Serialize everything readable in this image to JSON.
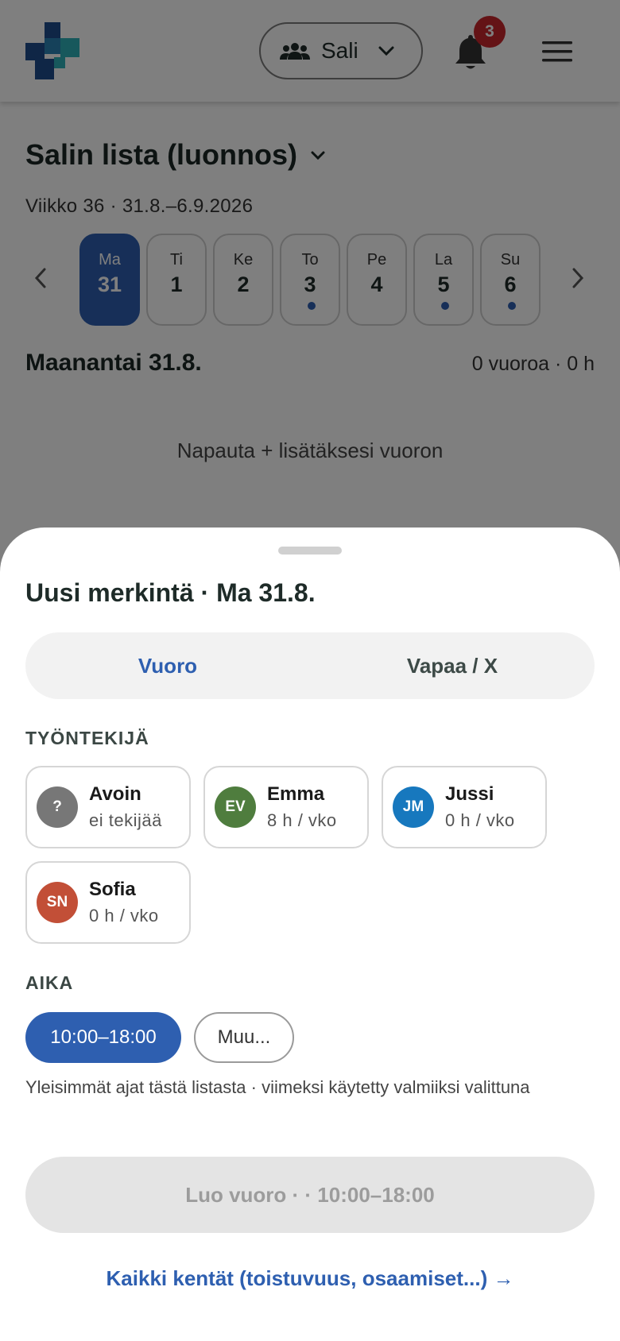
{
  "colors": {
    "accent": "#2e5fb0",
    "badge": "#c8272c",
    "open_avatar": "#777777",
    "emma_avatar": "#4f7d3e",
    "jussi_avatar": "#1778be",
    "sofia_avatar": "#c24f37",
    "logo_dark": "#1f4d8c",
    "logo_light": "#2eb0b8"
  },
  "header": {
    "logo_icon": "app-logo",
    "team_icon": "people-icon",
    "team_label": "Sali",
    "notifications_icon": "bell-icon",
    "notifications_count": "3",
    "menu_icon": "hamburger-menu-icon"
  },
  "schedule": {
    "title": "Salin lista (luonnos)",
    "week_info": "Viikko 36 · 31.8.–6.9.2026",
    "days": [
      {
        "name": "Ma",
        "date": "31",
        "selected": true,
        "has_dot": false
      },
      {
        "name": "Ti",
        "date": "1",
        "selected": false,
        "has_dot": false
      },
      {
        "name": "Ke",
        "date": "2",
        "selected": false,
        "has_dot": false
      },
      {
        "name": "To",
        "date": "3",
        "selected": false,
        "has_dot": true
      },
      {
        "name": "Pe",
        "date": "4",
        "selected": false,
        "has_dot": false
      },
      {
        "name": "La",
        "date": "5",
        "selected": false,
        "has_dot": true
      },
      {
        "name": "Su",
        "date": "6",
        "selected": false,
        "has_dot": true
      }
    ],
    "day_title": "Maanantai 31.8.",
    "day_summary": "0 vuoroa · 0 h",
    "empty_hint": "Napauta + lisätäksesi vuoron"
  },
  "sheet": {
    "title": "Uusi merkintä · Ma 31.8.",
    "tabs": [
      {
        "label": "Vuoro",
        "active": true
      },
      {
        "label": "Vapaa / X",
        "active": false
      }
    ],
    "employee_section": "TYÖNTEKIJÄ",
    "employees": [
      {
        "initials": "?",
        "name": "Avoin",
        "sub": "ei tekijää"
      },
      {
        "initials": "EV",
        "name": "Emma",
        "sub": "8 h / vko"
      },
      {
        "initials": "JM",
        "name": "Jussi",
        "sub": "0 h / vko"
      },
      {
        "initials": "SN",
        "name": "Sofia",
        "sub": "0 h / vko"
      }
    ],
    "time_section": "AIKA",
    "time_selected": "10:00–18:00",
    "time_other": "Muu...",
    "time_hint": "Yleisimmät ajat tästä listasta · viimeksi käytetty valmiiksi valittuna",
    "create_label": "Luo vuoro · · 10:00–18:00",
    "all_fields_label": "Kaikki kentät (toistuvuus, osaamiset...) →"
  }
}
